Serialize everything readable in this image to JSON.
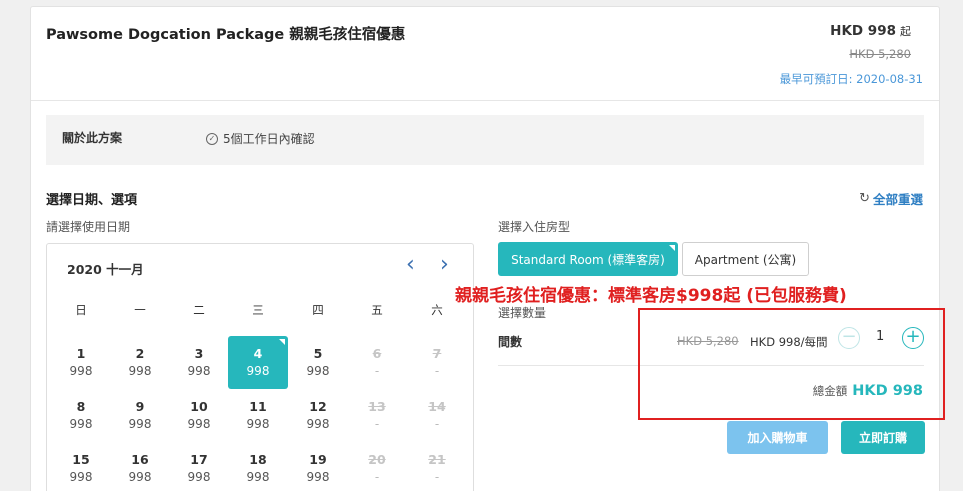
{
  "header": {
    "title": "Pawsome Dogcation Package 親親毛孩住宿優惠",
    "price_from": "HKD 998",
    "price_from_suffix": "起",
    "original_price": "HKD 5,280",
    "earliest_booking": "最早可預訂日: 2020-08-31"
  },
  "about": {
    "label": "關於此方案",
    "confirm_text": "5個工作日內確認"
  },
  "selection": {
    "title": "選擇日期、選項",
    "reset": "全部重選",
    "date_label": "請選擇使用日期",
    "room_label": "選擇入住房型",
    "qty_label": "選擇數量"
  },
  "calendar": {
    "month": "2020 十一月",
    "weekdays": [
      "日",
      "一",
      "二",
      "三",
      "四",
      "五",
      "六"
    ],
    "weeks": [
      [
        {
          "d": "1",
          "p": "998"
        },
        {
          "d": "2",
          "p": "998"
        },
        {
          "d": "3",
          "p": "998"
        },
        {
          "d": "4",
          "p": "998",
          "sel": true
        },
        {
          "d": "5",
          "p": "998"
        },
        {
          "d": "6",
          "p": "-",
          "dis": true
        },
        {
          "d": "7",
          "p": "-",
          "dis": true
        }
      ],
      [
        {
          "d": "8",
          "p": "998"
        },
        {
          "d": "9",
          "p": "998"
        },
        {
          "d": "10",
          "p": "998"
        },
        {
          "d": "11",
          "p": "998"
        },
        {
          "d": "12",
          "p": "998"
        },
        {
          "d": "13",
          "p": "-",
          "dis": true
        },
        {
          "d": "14",
          "p": "-",
          "dis": true
        }
      ],
      [
        {
          "d": "15",
          "p": "998"
        },
        {
          "d": "16",
          "p": "998"
        },
        {
          "d": "17",
          "p": "998"
        },
        {
          "d": "18",
          "p": "998"
        },
        {
          "d": "19",
          "p": "998"
        },
        {
          "d": "20",
          "p": "-",
          "dis": true
        },
        {
          "d": "21",
          "p": "-",
          "dis": true
        }
      ]
    ]
  },
  "rooms": [
    {
      "label": "Standard Room (標準客房)",
      "selected": true
    },
    {
      "label": "Apartment (公寓)",
      "selected": false
    }
  ],
  "quantity": {
    "label": "間數",
    "original": "HKD 5,280",
    "unit_price": "HKD 998/每間",
    "value": "1"
  },
  "total": {
    "label": "總金額",
    "value": "HKD 998"
  },
  "buttons": {
    "cart": "加入購物車",
    "buy": "立即訂購"
  },
  "annotation": "親親毛孩住宿優惠：標準客房$998起 (已包服務費)",
  "colors": {
    "accent": "#26b7bc",
    "link": "#4a97d8",
    "cart_button": "#7cc3ee",
    "annotation": "#e02020"
  }
}
